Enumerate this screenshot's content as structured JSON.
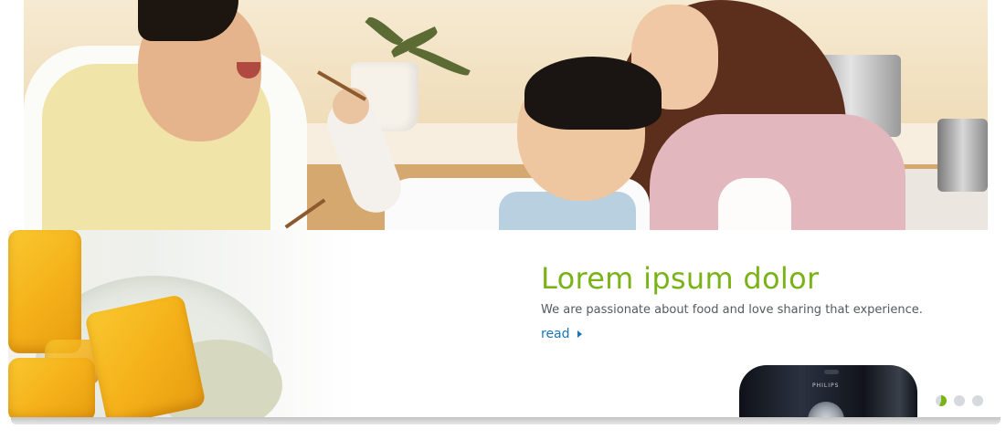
{
  "banner": {
    "headline": "Lorem ipsum dolor",
    "subtext": "We are passionate about food and love sharing that experience.",
    "read_label": "read",
    "product_brand": "PHILIPS"
  },
  "colors": {
    "headline_green": "#7ab317",
    "link_blue": "#1a74b8",
    "body_text": "#555a5e",
    "dot_inactive": "#d6d9de"
  },
  "slider": {
    "total_slides": 3,
    "active_index": 0,
    "active_progress": 0.55
  },
  "icons": {
    "read_arrow": "chevron-right-icon"
  }
}
